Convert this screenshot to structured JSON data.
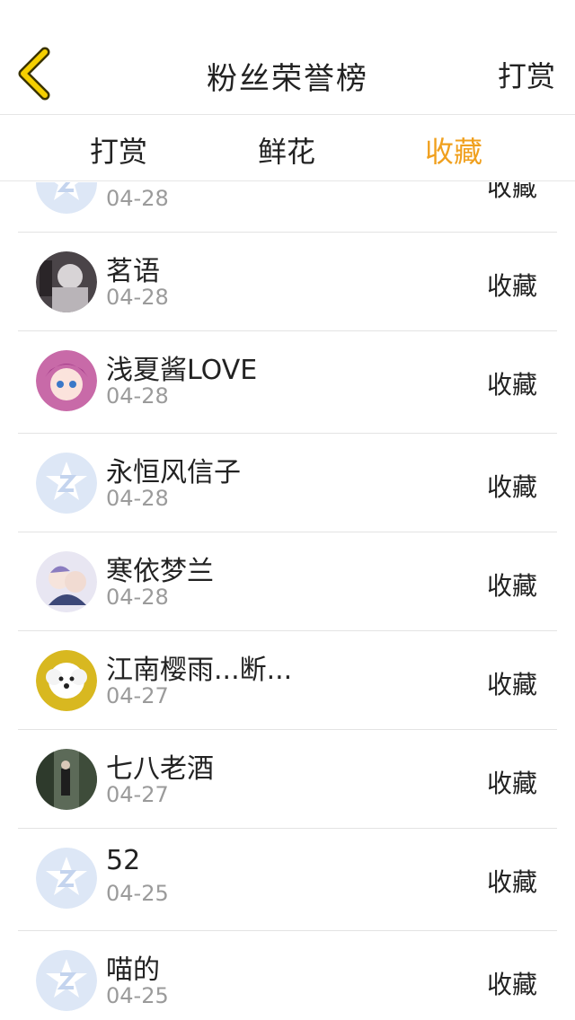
{
  "header": {
    "title": "粉丝荣誉榜",
    "action_label": "打赏"
  },
  "tabs": [
    {
      "label": "打赏",
      "active": false
    },
    {
      "label": "鲜花",
      "active": false
    },
    {
      "label": "收藏",
      "active": true
    }
  ],
  "colors": {
    "accent": "#f0a01e",
    "back_icon": "#f5d000",
    "divider": "#e3e3e3",
    "date_text": "#9b9b9b",
    "default_avatar": "#dde7f6"
  },
  "rows": [
    {
      "name": "",
      "date": "04-28",
      "action": "收藏",
      "avatar": "default-avatar"
    },
    {
      "name": "茗语",
      "date": "04-28",
      "action": "收藏",
      "avatar": "photo-avatar-dark"
    },
    {
      "name": "浅夏酱LOVE",
      "date": "04-28",
      "action": "收藏",
      "avatar": "anime-avatar-pink"
    },
    {
      "name": "永恒风信子",
      "date": "04-28",
      "action": "收藏",
      "avatar": "default-avatar"
    },
    {
      "name": "寒依梦兰",
      "date": "04-28",
      "action": "收藏",
      "avatar": "anime-avatar-couple"
    },
    {
      "name": "江南樱雨...断...",
      "date": "04-27",
      "action": "收藏",
      "avatar": "dog-avatar"
    },
    {
      "name": "七八老酒",
      "date": "04-27",
      "action": "收藏",
      "avatar": "photo-avatar-street"
    },
    {
      "name": "52",
      "date": "04-25",
      "action": "收藏",
      "avatar": "default-avatar"
    },
    {
      "name": "喵的",
      "date": "04-25",
      "action": "收藏",
      "avatar": "default-avatar"
    }
  ]
}
